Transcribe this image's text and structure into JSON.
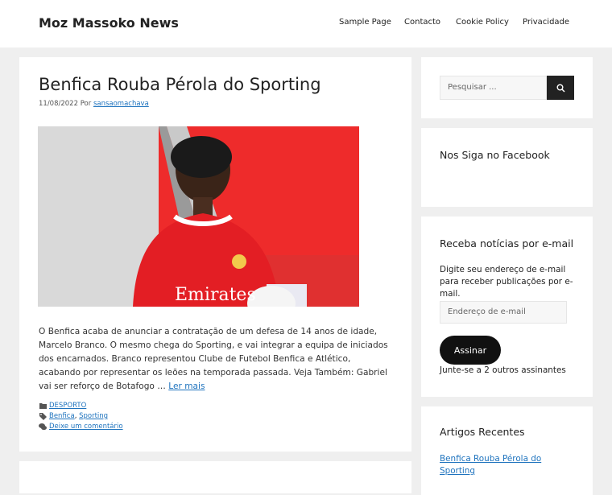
{
  "site": {
    "title": "Moz Massoko News"
  },
  "nav": [
    "Sample Page",
    "Contacto",
    "Cookie Policy",
    "Privacidade"
  ],
  "post": {
    "title": "Benfica Rouba Pérola do Sporting",
    "date": "11/08/2022",
    "by": "Por",
    "author": "sansaomachava",
    "excerpt": "O Benfica acaba de anunciar a contratação de um defesa de 14 anos de idade, Marcelo Branco. O mesmo chega do Sporting, e vai integrar a equipa de iniciados dos encarnados. Branco representou Clube de Futebol Benfica e Atlético, acabando por representar os leões na temporada passada. Veja Também: Gabriel vai ser reforço de Botafogo …",
    "read_more": "Ler mais",
    "shirt_sponsor": "Emirates",
    "category": "DESPORTO",
    "tags": [
      "Benfica",
      "Sporting"
    ],
    "tag_separator": ",",
    "comment_link": "Deixe um comentário"
  },
  "sidebar": {
    "search_placeholder": "Pesquisar ...",
    "facebook_title": "Nos Siga no Facebook",
    "email_title": "Receba notícias por e-mail",
    "email_desc": "Digite seu endereço de e-mail para receber publicações por e-mail.",
    "email_placeholder": "Endereço de e-mail",
    "subscribe_label": "Assinar",
    "subscribers_text": "Junte-se a 2 outros assinantes",
    "recent_title": "Artigos Recentes",
    "recent_posts": [
      "Benfica Rouba Pérola do Sporting"
    ]
  },
  "colors": {
    "link": "#1e73be",
    "button_dark": "#111111",
    "background": "#efefef"
  },
  "icons": [
    "search-icon",
    "folder-icon",
    "tag-icon",
    "comment-icon"
  ]
}
